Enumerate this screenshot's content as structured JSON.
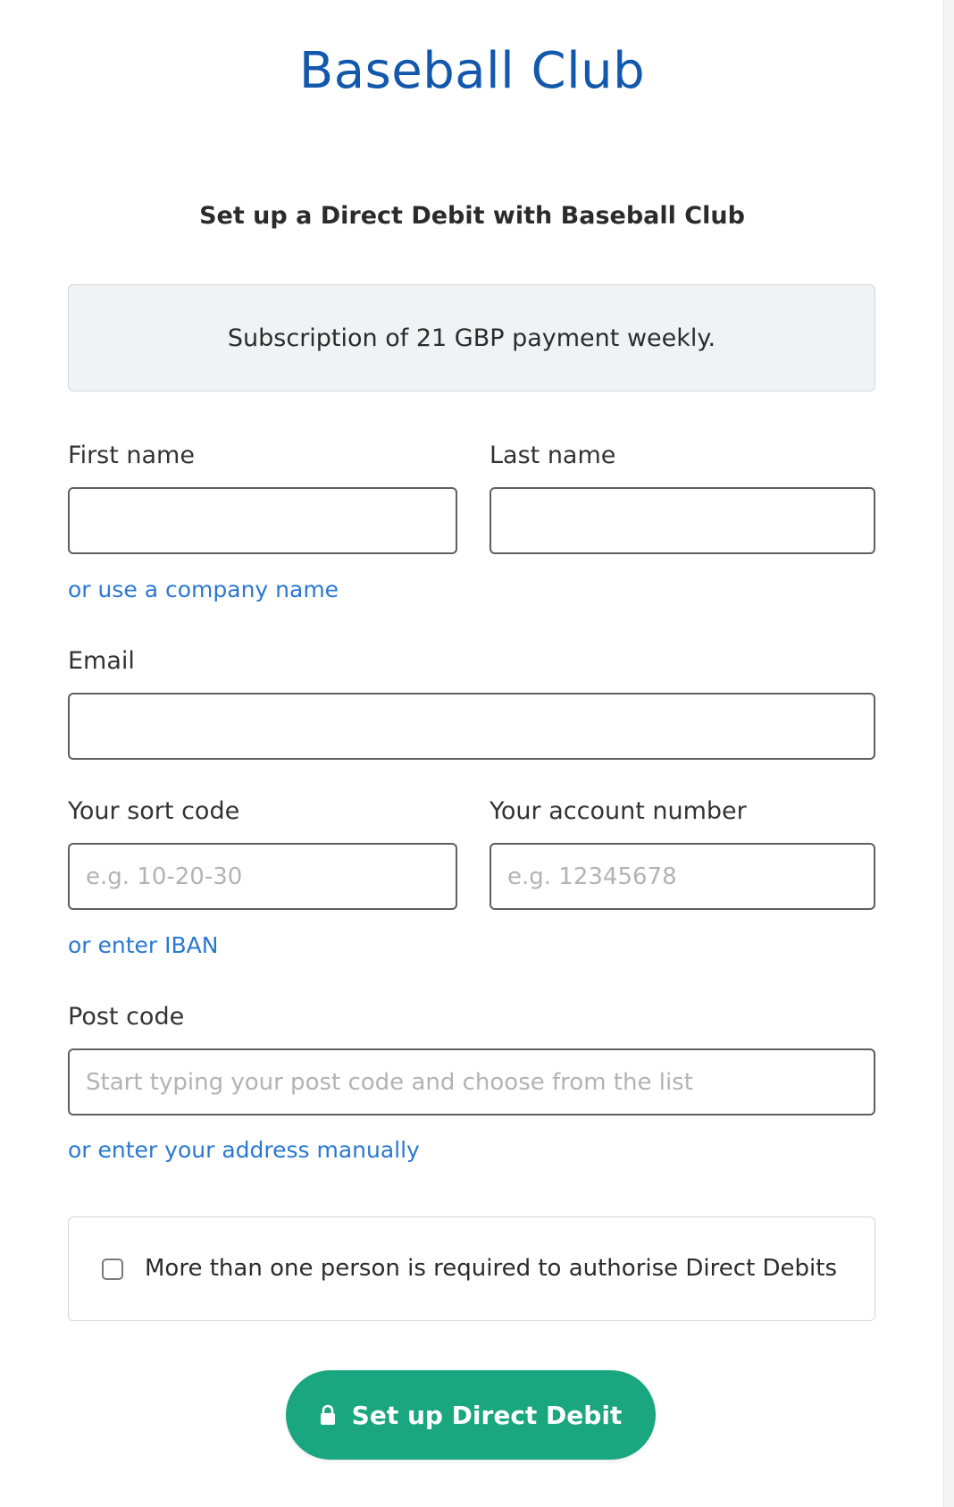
{
  "header": {
    "brand_name": "Baseball Club",
    "subtitle": "Set up a Direct Debit with Baseball Club"
  },
  "summary": {
    "text": "Subscription of 21 GBP payment weekly."
  },
  "form": {
    "first_name": {
      "label": "First name",
      "value": "",
      "placeholder": ""
    },
    "last_name": {
      "label": "Last name",
      "value": "",
      "placeholder": ""
    },
    "company_link": "or use a company name",
    "email": {
      "label": "Email",
      "value": "",
      "placeholder": ""
    },
    "sort_code": {
      "label": "Your sort code",
      "value": "",
      "placeholder": "e.g. 10-20-30"
    },
    "account_number": {
      "label": "Your account number",
      "value": "",
      "placeholder": "e.g. 12345678"
    },
    "iban_link": "or enter IBAN",
    "post_code": {
      "label": "Post code",
      "value": "",
      "placeholder": "Start typing your post code and choose from the list"
    },
    "address_link": "or enter your address manually",
    "multi_auth": {
      "label": "More than one person is required to authorise Direct Debits",
      "checked": false
    },
    "submit": {
      "label": "Set up Direct Debit",
      "icon": "lock-icon"
    }
  },
  "colors": {
    "brand": "#1358ac",
    "link": "#2a78d0",
    "button": "#1aa67f",
    "summary_bg": "#f1f2f5"
  }
}
